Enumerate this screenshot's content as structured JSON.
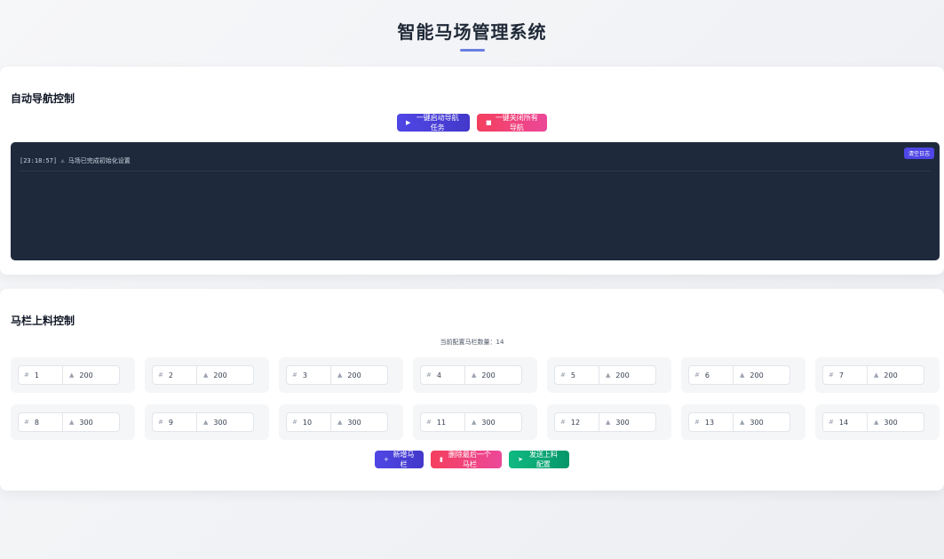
{
  "header": {
    "title": "智能马场管理系统"
  },
  "nav": {
    "title": "自动导航控制",
    "start_label": "一键启动导航任务",
    "stop_label": "一键关闭所有导航",
    "log_lines": [
      "[23:18:57] ⚠ 马场已完成初始化设置"
    ],
    "clear_label": "清空日志"
  },
  "feeding": {
    "title": "马栏上料控制",
    "count_text": "当前配置马栏数量：14",
    "stalls": [
      {
        "id": "1",
        "amount": "200"
      },
      {
        "id": "2",
        "amount": "200"
      },
      {
        "id": "3",
        "amount": "200"
      },
      {
        "id": "4",
        "amount": "200"
      },
      {
        "id": "5",
        "amount": "200"
      },
      {
        "id": "6",
        "amount": "200"
      },
      {
        "id": "7",
        "amount": "200"
      },
      {
        "id": "8",
        "amount": "300"
      },
      {
        "id": "9",
        "amount": "300"
      },
      {
        "id": "10",
        "amount": "300"
      },
      {
        "id": "11",
        "amount": "300"
      },
      {
        "id": "12",
        "amount": "300"
      },
      {
        "id": "13",
        "amount": "300"
      },
      {
        "id": "14",
        "amount": "300"
      }
    ],
    "add_label": "新增马栏",
    "delete_label": "删除最后一个马栏",
    "send_label": "发送上料配置"
  },
  "icons": {
    "play": "play-icon",
    "stop": "stop-icon",
    "hash": "hash-icon",
    "feed": "feed-icon",
    "plus": "plus-icon",
    "trash": "trash-icon",
    "send": "send-icon"
  },
  "colors": {
    "primary": "#4f46e5",
    "danger": "#f43f5e",
    "success": "#10b981",
    "log_bg": "#1e293b"
  }
}
